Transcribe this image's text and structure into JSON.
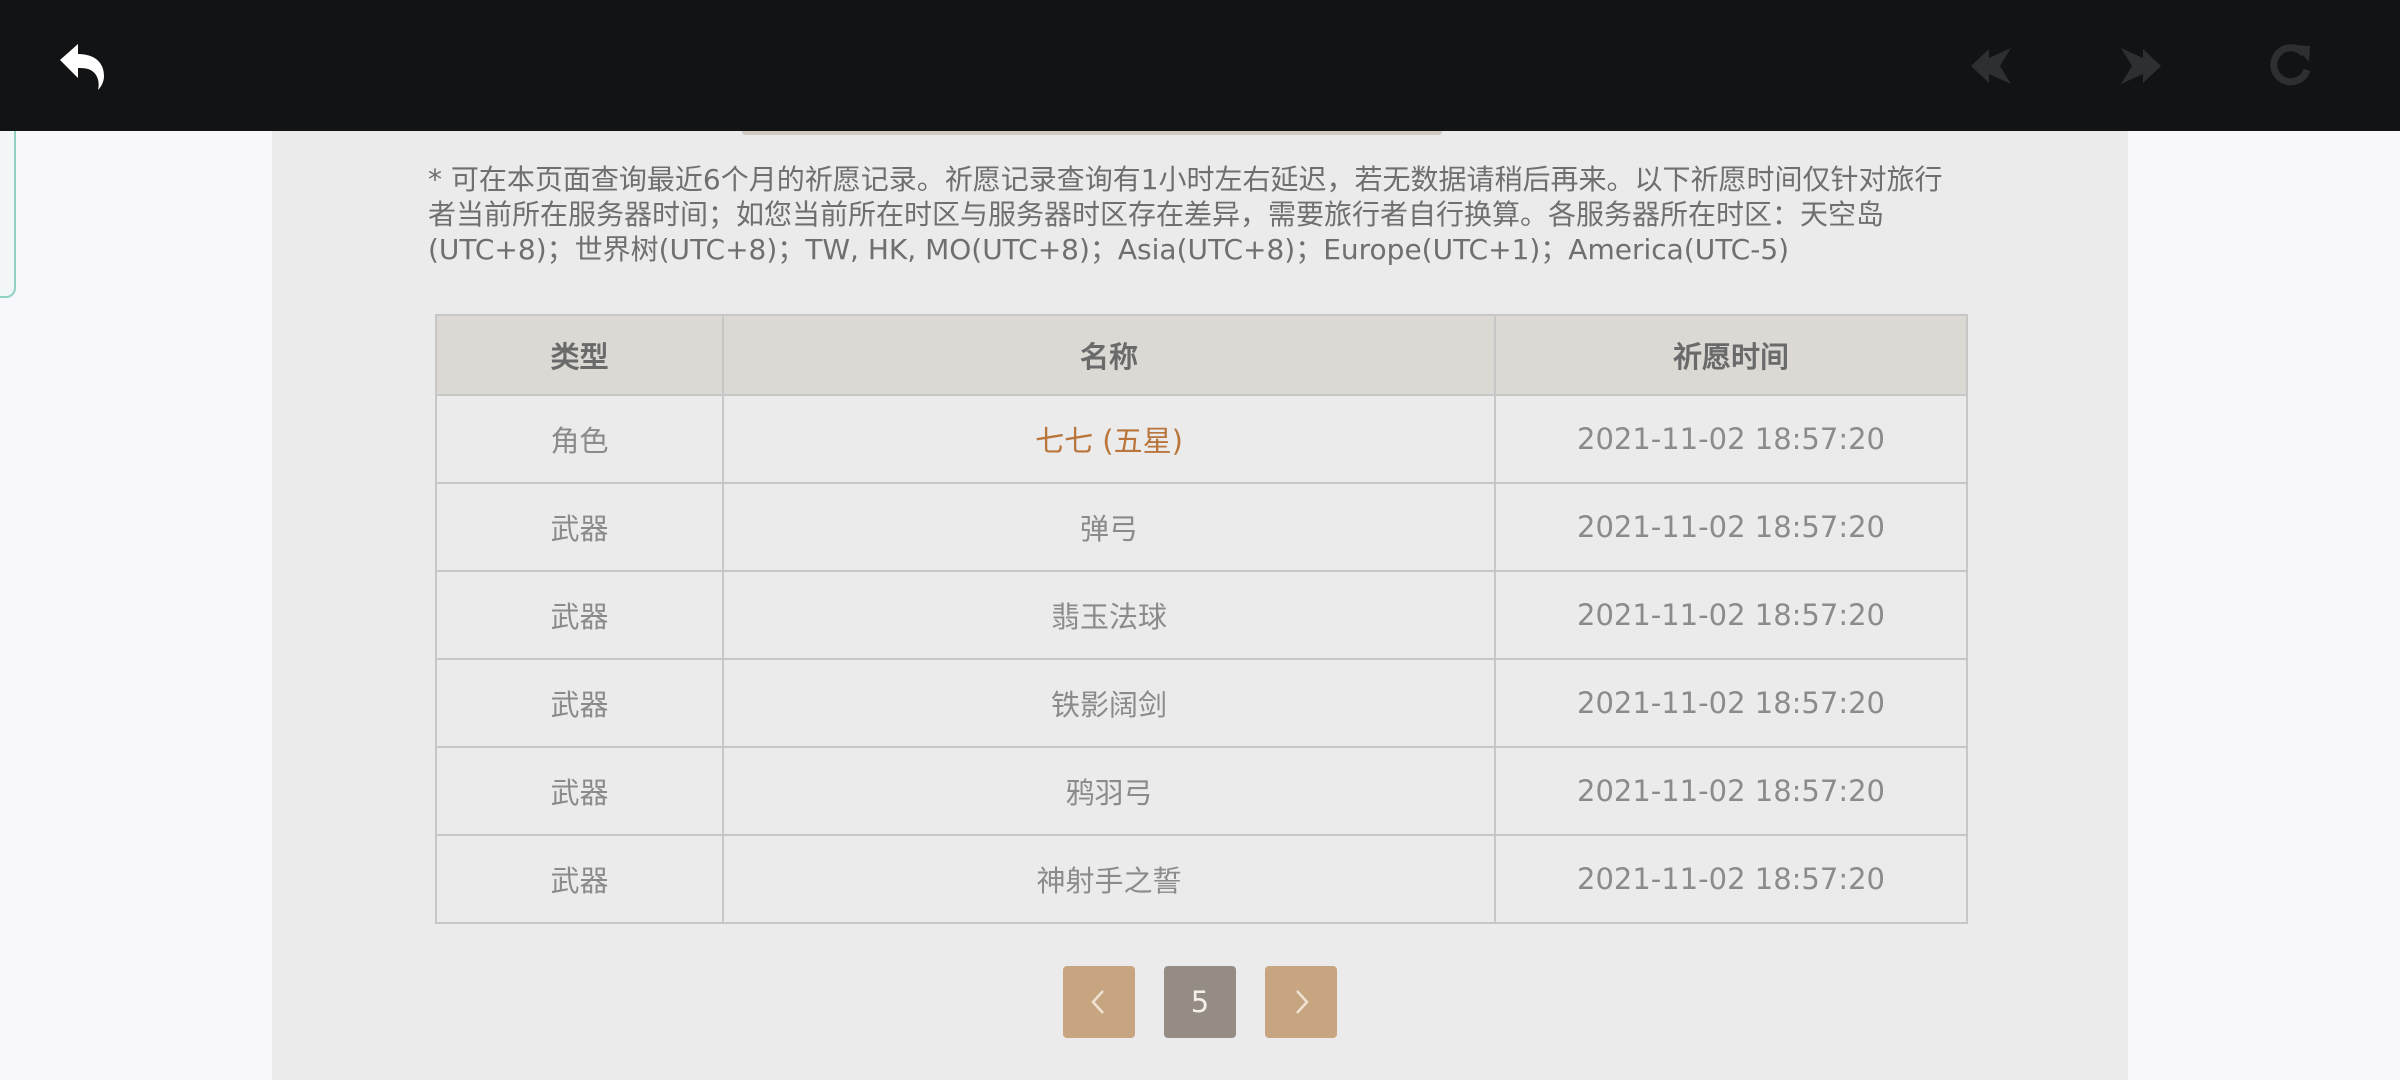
{
  "toolbar": {
    "back_icon": "back-arrow-icon",
    "prev_icon": "navigate-back-icon",
    "next_icon": "navigate-forward-icon",
    "reload_icon": "reload-icon"
  },
  "notice": "* 可在本页面查询最近6个月的祈愿记录。祈愿记录查询有1小时左右延迟，若无数据请稍后再来。以下祈愿时间仅针对旅行者当前所在服务器时间；如您当前所在时区与服务器时区存在差异，需要旅行者自行换算。各服务器所在时区：天空岛(UTC+8)；世界树(UTC+8)；TW, HK, MO(UTC+8)；Asia(UTC+8)；Europe(UTC+1)；America(UTC-5)",
  "table": {
    "headers": [
      "类型",
      "名称",
      "祈愿时间"
    ],
    "rows": [
      {
        "type": "角色",
        "name": "七七 (五星)",
        "time": "2021-11-02 18:57:20"
      },
      {
        "type": "武器",
        "name": "弹弓",
        "time": "2021-11-02 18:57:20"
      },
      {
        "type": "武器",
        "name": "翡玉法球",
        "time": "2021-11-02 18:57:20"
      },
      {
        "type": "武器",
        "name": "铁影阔剑",
        "time": "2021-11-02 18:57:20"
      },
      {
        "type": "武器",
        "name": "鸦羽弓",
        "time": "2021-11-02 18:57:20"
      },
      {
        "type": "武器",
        "name": "神射手之誓",
        "time": "2021-11-02 18:57:20"
      }
    ]
  },
  "pagination": {
    "current_page": "5",
    "prev_icon": "chevron-left-icon",
    "next_icon": "chevron-right-icon"
  },
  "colors": {
    "toolbar_bg": "#121315",
    "panel_bg": "#ebebeb",
    "header_bg": "#dcd9d4",
    "five_star_text": "#b9753c",
    "pager_button": "#c8a581",
    "pager_current": "#958c84"
  }
}
